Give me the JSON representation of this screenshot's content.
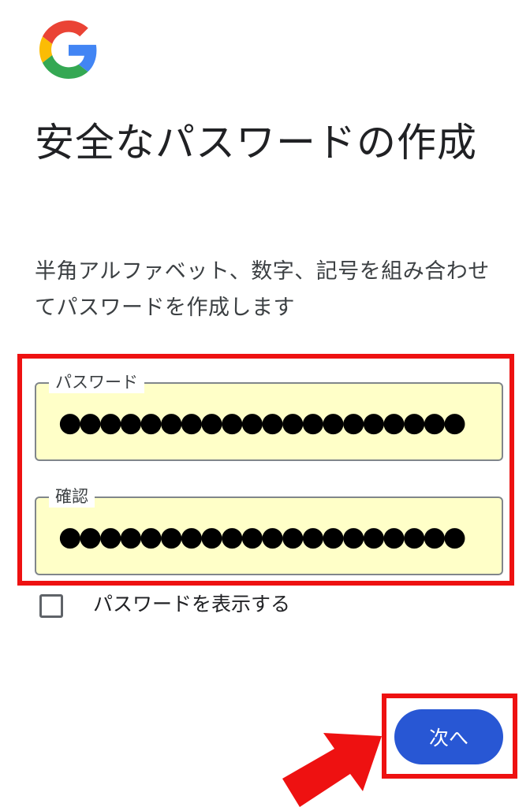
{
  "title": "安全なパスワードの作成",
  "subtitle": "半角アルファベット、数字、記号を組み合わせてパスワードを作成します",
  "password_field": {
    "label": "パスワード",
    "value": "●●●●●●●●●●●●●●●●●●●●"
  },
  "confirm_field": {
    "label": "確認",
    "value": "●●●●●●●●●●●●●●●●●●●●"
  },
  "show_password": {
    "label": "パスワードを表示する",
    "checked": false
  },
  "next_button": {
    "label": "次へ"
  },
  "icons": {
    "logo": "google-logo-icon",
    "pointer": "red-arrow-icon"
  },
  "colors": {
    "accent": "#2857d4",
    "highlight": "#ee1111",
    "field_fill": "#ffffc8"
  }
}
